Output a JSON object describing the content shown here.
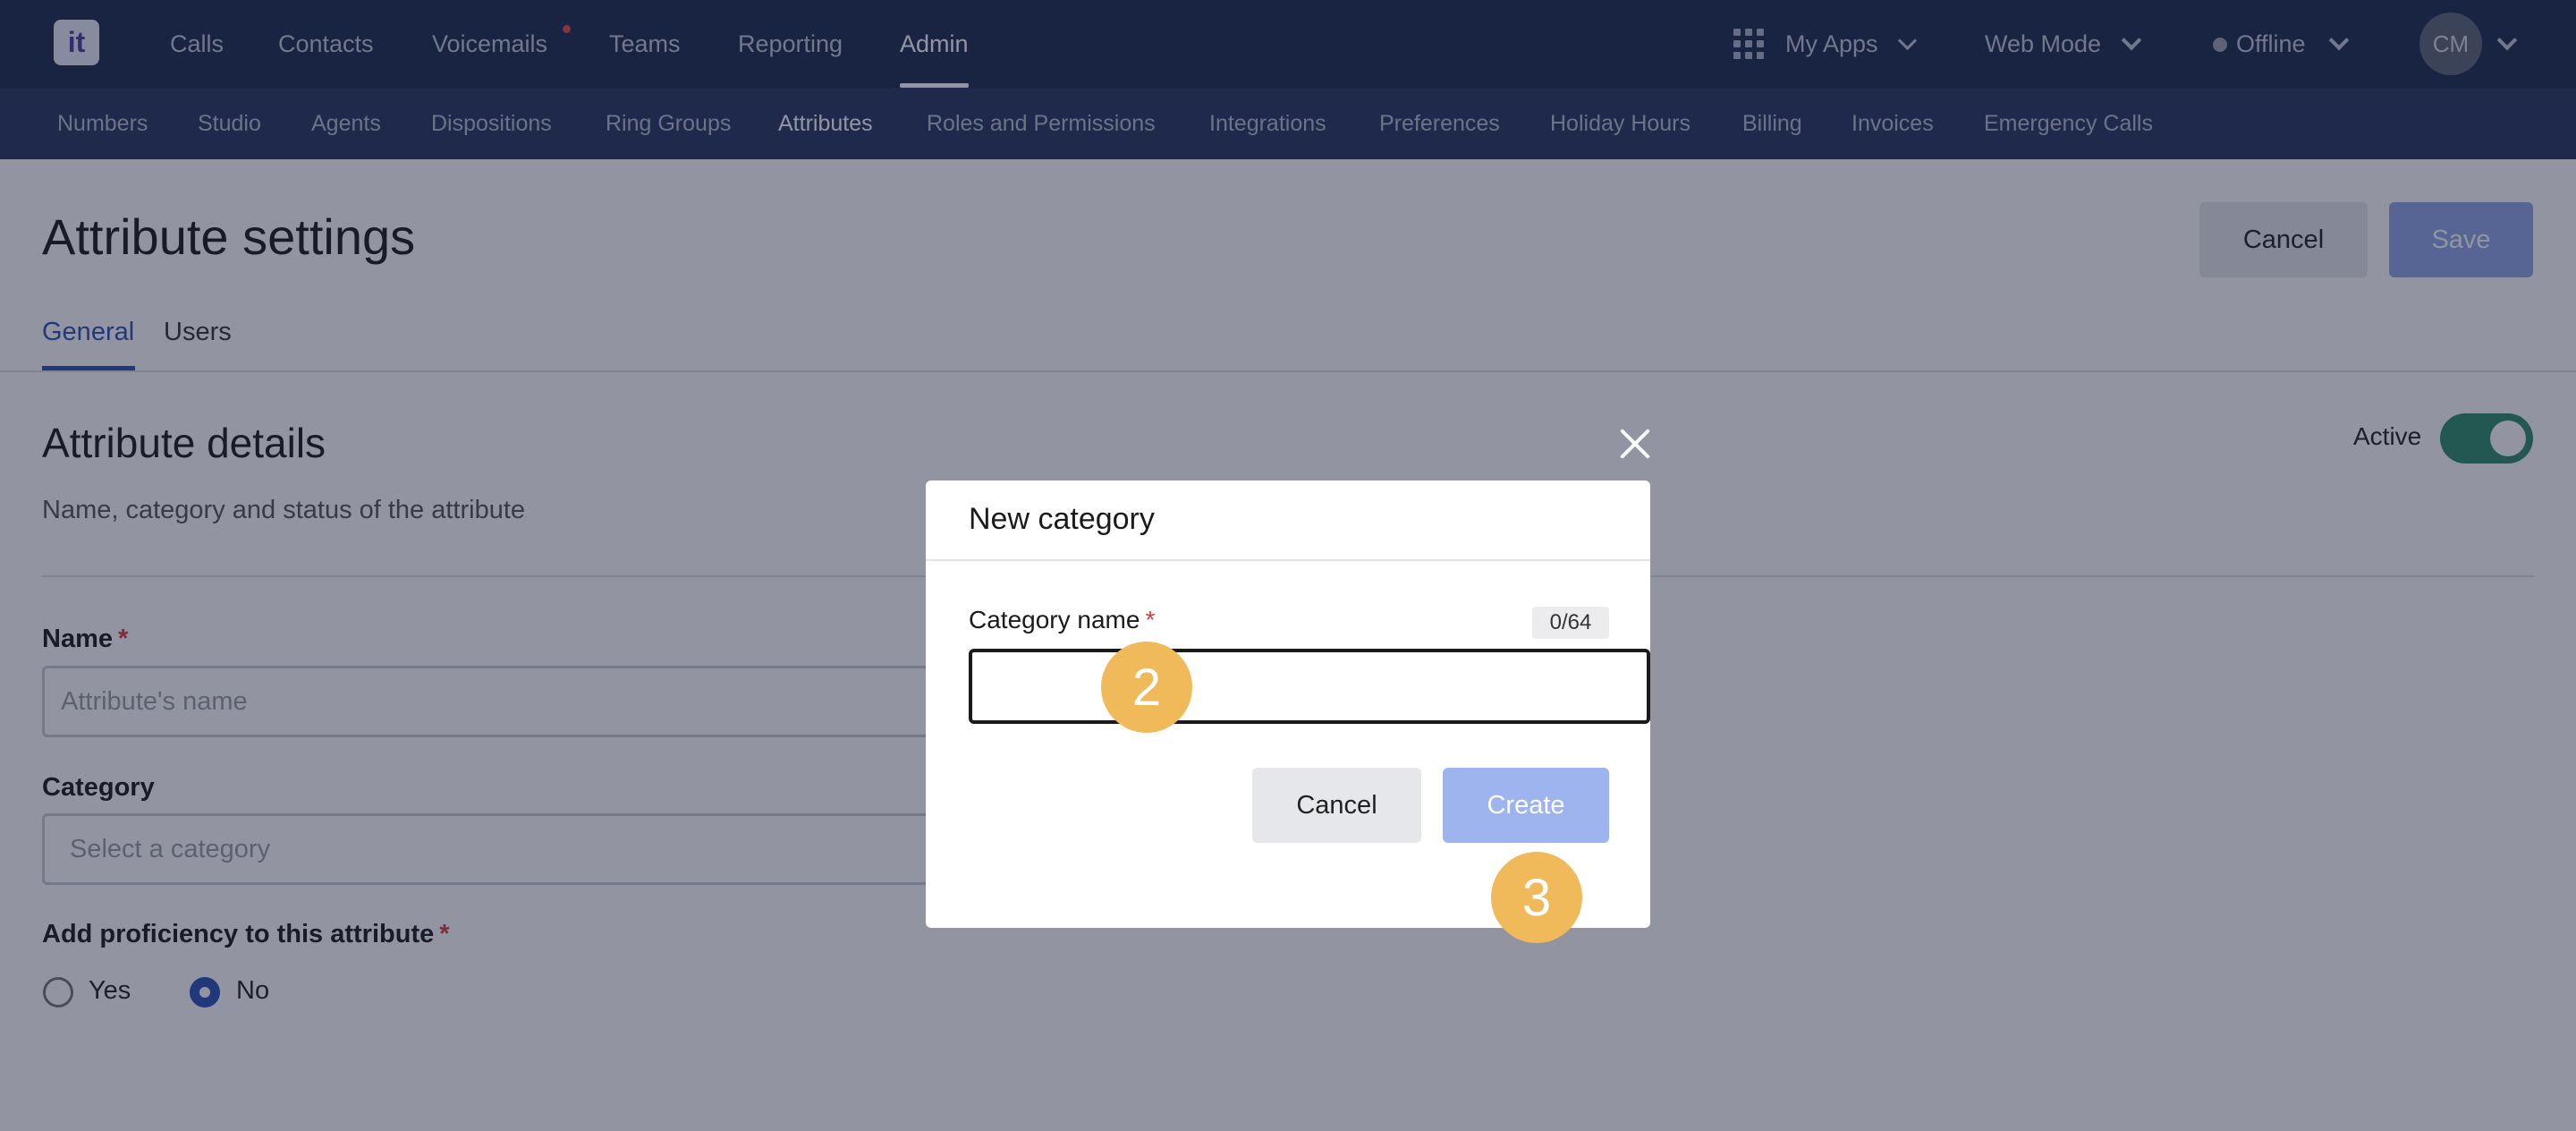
{
  "topnav": {
    "logo_text": "it",
    "items": [
      {
        "label": "Calls"
      },
      {
        "label": "Contacts"
      },
      {
        "label": "Voicemails"
      },
      {
        "label": "Teams"
      },
      {
        "label": "Reporting"
      },
      {
        "label": "Admin"
      }
    ],
    "my_apps": "My Apps",
    "web_mode": "Web Mode",
    "status": "Offline",
    "avatar_initials": "CM"
  },
  "subnav": {
    "items": [
      {
        "label": "Numbers"
      },
      {
        "label": "Studio"
      },
      {
        "label": "Agents"
      },
      {
        "label": "Dispositions"
      },
      {
        "label": "Ring Groups"
      },
      {
        "label": "Attributes"
      },
      {
        "label": "Roles and Permissions"
      },
      {
        "label": "Integrations"
      },
      {
        "label": "Preferences"
      },
      {
        "label": "Holiday Hours"
      },
      {
        "label": "Billing"
      },
      {
        "label": "Invoices"
      },
      {
        "label": "Emergency Calls"
      }
    ]
  },
  "page": {
    "title": "Attribute settings",
    "cancel_label": "Cancel",
    "save_label": "Save",
    "tabs": [
      {
        "label": "General"
      },
      {
        "label": "Users"
      }
    ],
    "section_title": "Attribute details",
    "section_subtitle": "Name, category and status of the attribute",
    "active_label": "Active",
    "name_label": "Name",
    "name_placeholder": "Attribute's name",
    "category_label": "Category",
    "category_placeholder": "Select a category",
    "proficiency_label": "Add proficiency to this attribute",
    "radio_yes": "Yes",
    "radio_no": "No",
    "required_mark": "*"
  },
  "modal": {
    "title": "New category",
    "field_label": "Category name",
    "required_mark": "*",
    "counter": "0/64",
    "input_value": "",
    "cancel_label": "Cancel",
    "create_label": "Create"
  },
  "badges": {
    "step_2": "2",
    "step_3": "3"
  },
  "colors": {
    "topbar": "#1b2a4e",
    "subbar": "#24345d",
    "accent": "#2a52b8",
    "toggle_on": "#2f8a6a",
    "badge": "#f0b95a"
  }
}
